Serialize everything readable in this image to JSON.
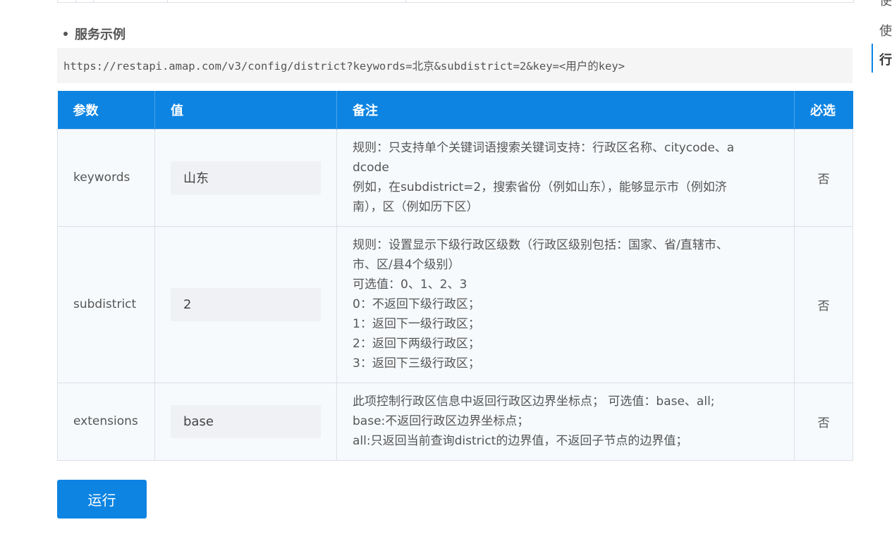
{
  "section": {
    "title": "服务示例"
  },
  "request_url": "https://restapi.amap.com/v3/config/district?keywords=北京&subdistrict=2&key=<用户的key>",
  "table": {
    "headers": {
      "param": "参数",
      "value": "值",
      "note": "备注",
      "required": "必选"
    },
    "rows": [
      {
        "param": "keywords",
        "value": "山东",
        "note_lines": [
          "规则：只支持单个关键词语搜索关键词支持：行政区名称、citycode、a",
          "dcode",
          "例如，在subdistrict=2，搜索省份（例如山东），能够显示市（例如济",
          "南），区（例如历下区）"
        ],
        "required": "否"
      },
      {
        "param": "subdistrict",
        "value": "2",
        "note_lines": [
          "规则：设置显示下级行政区级数（行政区级别包括：国家、省/直辖市、",
          "市、区/县4个级别）",
          "可选值：0、1、2、3",
          "0：不返回下级行政区；",
          "1：返回下一级行政区；",
          "2：返回下两级行政区；",
          "3：返回下三级行政区；"
        ],
        "required": "否"
      },
      {
        "param": "extensions",
        "value": "base",
        "note_lines": [
          "此项控制行政区信息中返回行政区边界坐标点； 可选值：base、all;",
          "base:不返回行政区边界坐标点；",
          "all:只返回当前查询district的边界值，不返回子节点的边界值；"
        ],
        "required": "否"
      }
    ]
  },
  "run_button": {
    "label": "运行"
  },
  "side_nav": {
    "items": [
      "使",
      "使",
      "行"
    ],
    "active_index": 2
  },
  "colors": {
    "accent": "#0d84e2",
    "input_bg": "#eff1f4",
    "cell_bg": "#f7fafd",
    "url_bg": "#f5f5f5"
  }
}
